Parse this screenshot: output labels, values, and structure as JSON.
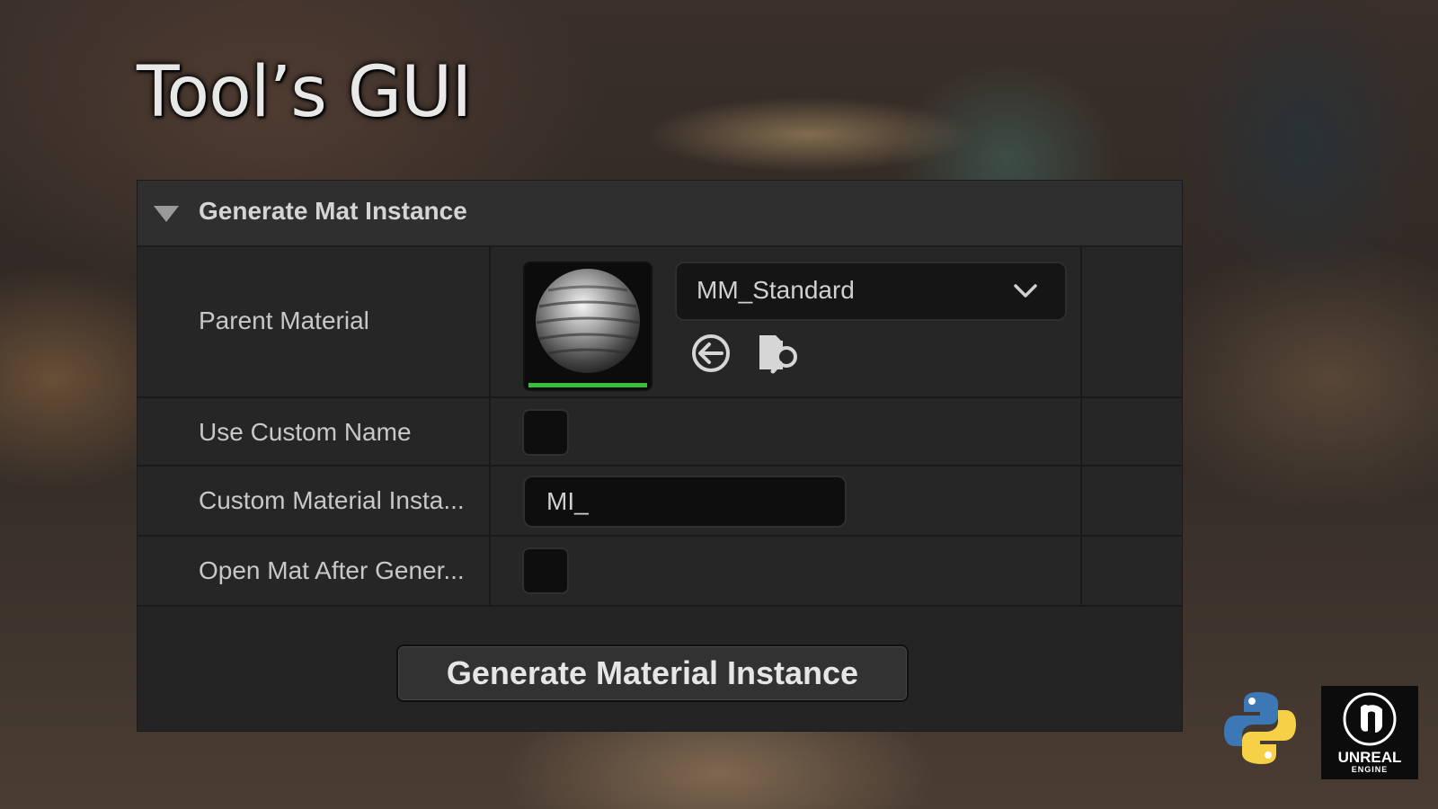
{
  "title": "Tool’s GUI",
  "panel": {
    "header_title": "Generate Mat Instance",
    "rows": {
      "parent_material": {
        "label": "Parent Material",
        "selected": "MM_Standard"
      },
      "use_custom_name": {
        "label": "Use Custom Name",
        "checked": false
      },
      "custom_instance_name": {
        "label": "Custom Material Insta...",
        "value": "MI_"
      },
      "open_after_generate": {
        "label": "Open Mat After Gener...",
        "checked": false
      }
    },
    "generate_button_label": "Generate Material Instance"
  },
  "logos": {
    "unreal_word": "UNREAL",
    "unreal_sub": "ENGINE"
  },
  "icons": [
    "chevron-down-icon",
    "use-selected-arrow-icon",
    "browse-folder-icon",
    "python-logo",
    "unreal-engine-logo"
  ],
  "colors": {
    "panel_bg": "#242424",
    "header_bg": "#2f2f2f",
    "thumbnail_bar": "#3bbf3b",
    "text": "#c8c8c8"
  }
}
